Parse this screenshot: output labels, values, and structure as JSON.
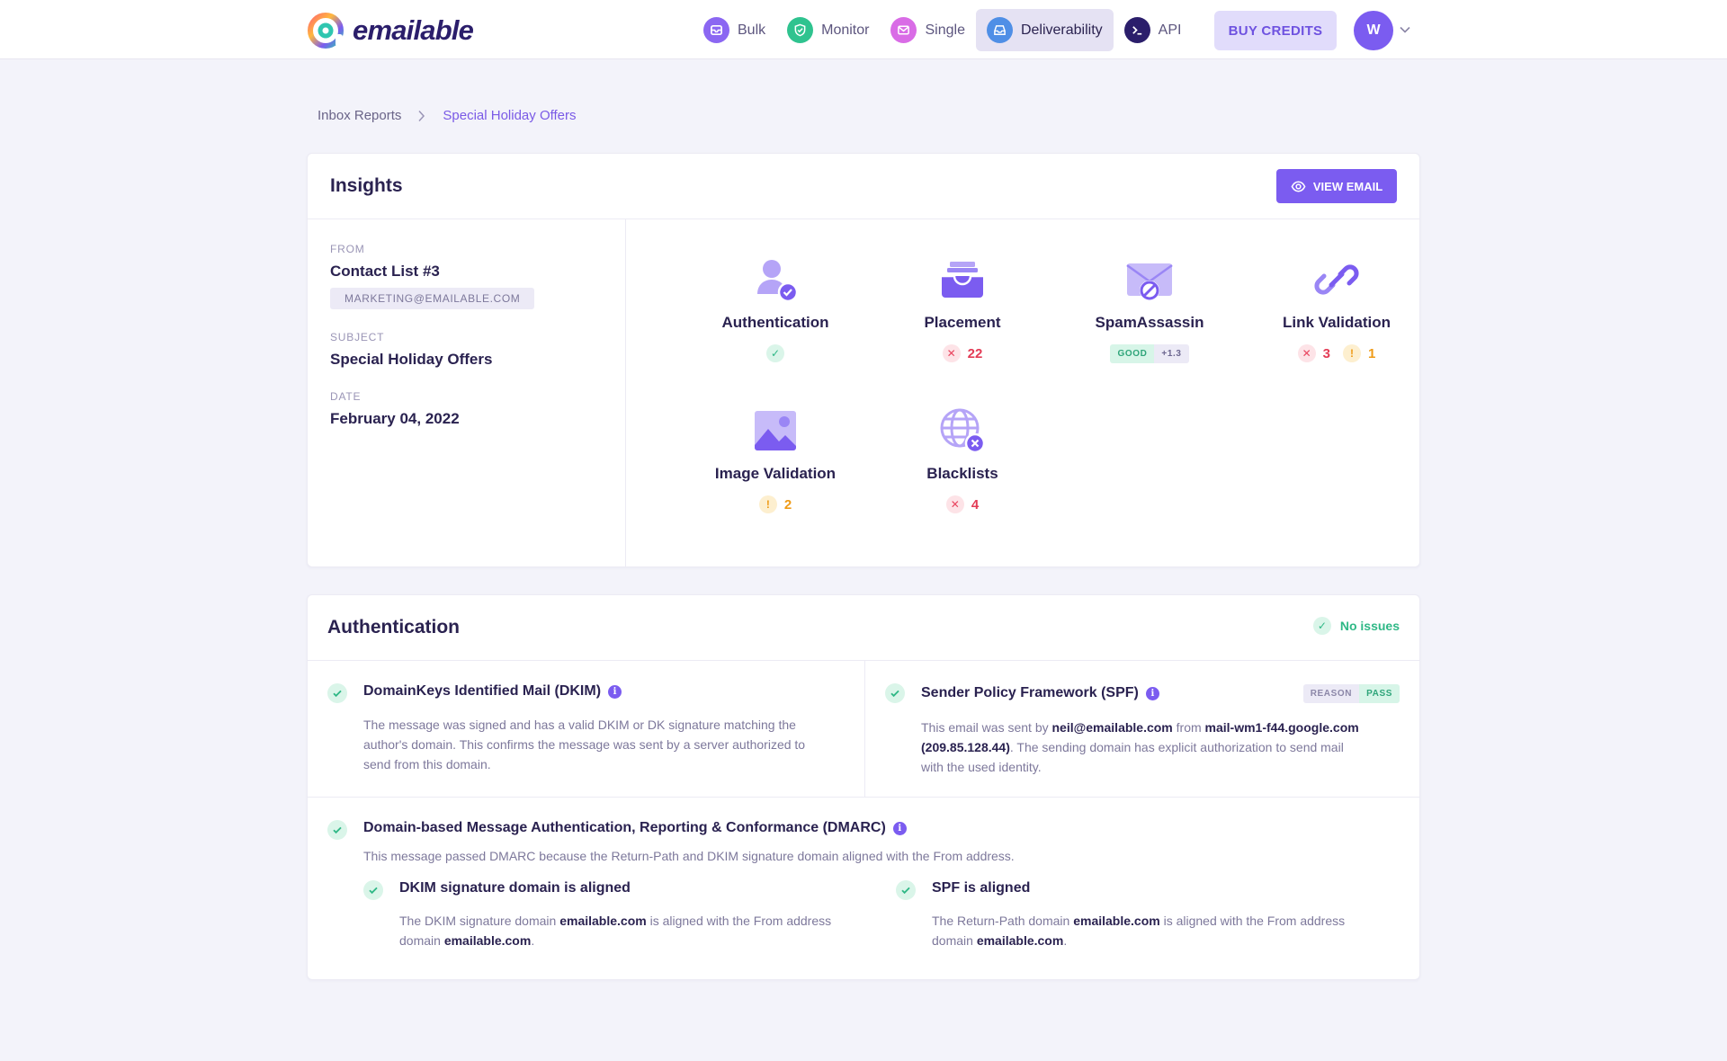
{
  "brand": {
    "name": "emailable"
  },
  "nav": {
    "items": [
      {
        "label": "Bulk",
        "icon": "bulk-icon"
      },
      {
        "label": "Monitor",
        "icon": "shield-icon"
      },
      {
        "label": "Single",
        "icon": "envelope-icon"
      },
      {
        "label": "Deliverability",
        "icon": "inbox-icon",
        "active": true
      },
      {
        "label": "API",
        "icon": "terminal-icon"
      }
    ],
    "buy_credits": "BUY CREDITS",
    "avatar_initial": "W"
  },
  "breadcrumb": {
    "parent": "Inbox Reports",
    "current": "Special Holiday Offers"
  },
  "insights": {
    "title": "Insights",
    "view_email": "VIEW EMAIL",
    "from_label": "FROM",
    "from_name": "Contact List #3",
    "from_email": "MARKETING@EMAILABLE.COM",
    "subject_label": "SUBJECT",
    "subject": "Special Holiday Offers",
    "date_label": "DATE",
    "date": "February 04, 2022",
    "tiles": {
      "authentication": {
        "name": "Authentication"
      },
      "placement": {
        "name": "Placement",
        "errors": "22"
      },
      "spamassassin": {
        "name": "SpamAssassin",
        "rating": "GOOD",
        "score": "+1.3"
      },
      "link_validation": {
        "name": "Link Validation",
        "errors": "3",
        "warnings": "1"
      },
      "image_validation": {
        "name": "Image Validation",
        "warnings": "2"
      },
      "blacklists": {
        "name": "Blacklists",
        "errors": "4"
      }
    }
  },
  "authentication": {
    "title": "Authentication",
    "status": "No issues",
    "dkim": {
      "title": "DomainKeys Identified Mail (DKIM)",
      "line1": "The message was signed and has a valid DKIM or DK signature matching the",
      "line2": "author's domain. This confirms the message was sent by a server authorized to",
      "line3": "send from this domain."
    },
    "spf": {
      "title": "Sender Policy Framework (SPF)",
      "badge_reason": "REASON",
      "badge_pass": "PASS",
      "p1": "This email was sent by ",
      "sender": "neil@emailable.com",
      "p2": " from ",
      "server": "mail-wm1-f44.google.com",
      "ip": "(209.85.128.44)",
      "p3": ". The sending domain has explicit authorization to send mail",
      "p4": "with the used identity."
    },
    "dmarc": {
      "title": "Domain-based Message Authentication, Reporting & Conformance (DMARC)",
      "desc": "This message passed DMARC because the Return-Path and DKIM signature domain aligned with the From address.",
      "dkim_aligned": {
        "title": "DKIM signature domain is aligned",
        "t1": "The DKIM signature domain ",
        "domain": "emailable.com",
        "t2": " is aligned with the From address",
        "t3": "domain ",
        "domain2": "emailable.com",
        "t4": "."
      },
      "spf_aligned": {
        "title": "SPF is aligned",
        "t1": "The Return-Path domain ",
        "domain": "emailable.com",
        "t2": " is aligned with the From address",
        "t3": "domain ",
        "domain2": "emailable.com",
        "t4": "."
      }
    }
  },
  "colors": {
    "accent": "#7b5cf0",
    "success": "#2fb886",
    "error": "#e33c56",
    "warning": "#ef9b17"
  }
}
